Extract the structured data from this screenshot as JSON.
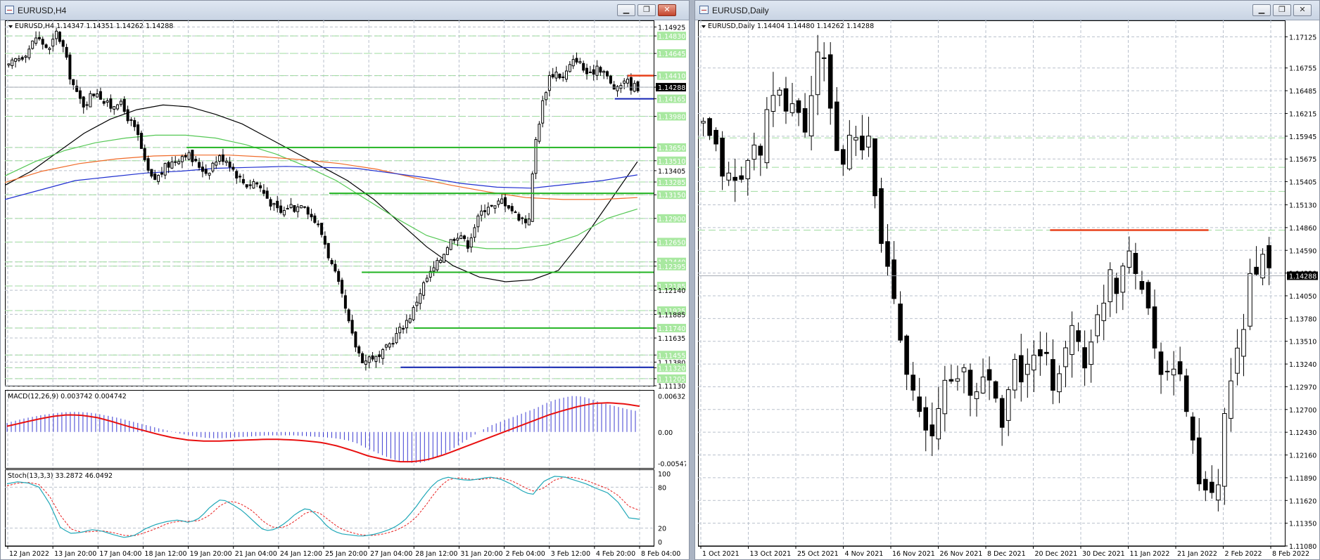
{
  "windows": [
    {
      "title": "EURUSD,H4",
      "symbol_info": "EURUSD,H4  1.14347 1.14351 1.14262 1.14288",
      "buttons": {
        "minimize": "",
        "maximize": "",
        "close": "✕"
      }
    },
    {
      "title": "EURUSD,Daily",
      "symbol_info": "EURUSD,Daily  1.14404 1.14480 1.14262 1.14288",
      "buttons": {
        "minimize": "",
        "maximize": "",
        "close": ""
      }
    }
  ],
  "colors": {
    "bull_fill": "#ffffff",
    "bear_fill": "#000000",
    "grid": "#b9c0cc",
    "level_line": "#9fdc9f",
    "level_label_bg": "#a8e8a0",
    "price_label_bg": "#000000",
    "ma_black": "#000000",
    "ma_green": "#55c855",
    "ma_orange": "#f06a28",
    "ma_blue": "#2030d0",
    "support_green": "#22b422",
    "support_blue": "#1424b4",
    "resistance_red": "#e8401a",
    "macd_hist": "#3c3cd2",
    "macd_signal": "#e81010",
    "stoch_main": "#20a8b8",
    "stoch_signal": "#e82020"
  },
  "chart_data": [
    {
      "id": "eurusd-h4",
      "type": "candlestick",
      "symbol": "EURUSD",
      "timeframe": "H4",
      "ohlc_text": "1.14347 1.14351 1.14262 1.14288",
      "current_price": "1.14288",
      "ylim": [
        1.1113,
        1.1495
      ],
      "y_ticks": [
        "1.14925",
        "1.14830",
        "1.14645",
        "1.14410",
        "1.14288",
        "1.14165",
        "1.13980",
        "1.13650",
        "1.13510",
        "1.13405",
        "1.13285",
        "1.13150",
        "1.12900",
        "1.12650",
        "1.12440",
        "1.12395",
        "1.12185",
        "1.12140",
        "1.11925",
        "1.11885",
        "1.11740",
        "1.11635",
        "1.11455",
        "1.11380",
        "1.11320",
        "1.11205",
        "1.11130"
      ],
      "green_level_labels": [
        "1.14830",
        "1.14645",
        "1.14410",
        "1.14165",
        "1.13980",
        "1.13650",
        "1.13510",
        "1.13285",
        "1.13150",
        "1.12900",
        "1.12650",
        "1.12440",
        "1.12395",
        "1.12185",
        "1.11925",
        "1.11740",
        "1.11455",
        "1.11320",
        "1.11205"
      ],
      "x_ticks": [
        "12 Jan 2022",
        "13 Jan 20:00",
        "17 Jan 04:00",
        "18 Jan 12:00",
        "19 Jan 20:00",
        "21 Jan 04:00",
        "24 Jan 12:00",
        "25 Jan 20:00",
        "27 Jan 04:00",
        "28 Jan 12:00",
        "31 Jan 20:00",
        "2 Feb 04:00",
        "3 Feb 12:00",
        "4 Feb 20:00",
        "8 Feb 04:00"
      ],
      "close_path": [
        1.145,
        1.1458,
        1.1462,
        1.147,
        1.1482,
        1.1475,
        1.1468,
        1.1487,
        1.147,
        1.144,
        1.142,
        1.141,
        1.142,
        1.1425,
        1.1412,
        1.1408,
        1.1415,
        1.1402,
        1.139,
        1.1375,
        1.1345,
        1.133,
        1.1335,
        1.1345,
        1.135,
        1.1355,
        1.136,
        1.135,
        1.1345,
        1.1338,
        1.135,
        1.1355,
        1.1352,
        1.134,
        1.133,
        1.1325,
        1.133,
        1.132,
        1.131,
        1.13,
        1.1295,
        1.1305,
        1.13,
        1.131,
        1.1295,
        1.1285,
        1.127,
        1.1245,
        1.1225,
        1.12,
        1.117,
        1.115,
        1.1138,
        1.1145,
        1.114,
        1.115,
        1.116,
        1.117,
        1.118,
        1.119,
        1.121,
        1.1225,
        1.1235,
        1.1245,
        1.126,
        1.127,
        1.1275,
        1.126,
        1.128,
        1.1295,
        1.1305,
        1.13,
        1.131,
        1.1305,
        1.1295,
        1.129,
        1.1285,
        1.137,
        1.141,
        1.144,
        1.1445,
        1.1438,
        1.145,
        1.146,
        1.1448,
        1.144,
        1.1452,
        1.1446,
        1.1432,
        1.1425,
        1.1438,
        1.143,
        1.1429
      ],
      "moving_averages": [
        {
          "color_key": "ma_black",
          "values": [
            1.1325,
            1.134,
            1.136,
            1.138,
            1.1395,
            1.1405,
            1.141,
            1.1408,
            1.14,
            1.139,
            1.1375,
            1.136,
            1.1345,
            1.133,
            1.131,
            1.1285,
            1.126,
            1.124,
            1.1228,
            1.1223,
            1.1225,
            1.1235,
            1.127,
            1.131,
            1.135
          ]
        },
        {
          "color_key": "ma_green",
          "values": [
            1.1335,
            1.135,
            1.1362,
            1.137,
            1.1375,
            1.1378,
            1.1378,
            1.1375,
            1.1368,
            1.1358,
            1.1345,
            1.133,
            1.131,
            1.129,
            1.1272,
            1.1262,
            1.1258,
            1.1258,
            1.1262,
            1.1272,
            1.129,
            1.13
          ]
        },
        {
          "color_key": "ma_orange",
          "values": [
            1.1328,
            1.134,
            1.1348,
            1.1353,
            1.1356,
            1.1357,
            1.1357,
            1.1355,
            1.1352,
            1.1348,
            1.1342,
            1.1333,
            1.1325,
            1.1318,
            1.1312,
            1.131,
            1.131,
            1.1312
          ]
        },
        {
          "color_key": "ma_blue",
          "values": [
            1.131,
            1.132,
            1.133,
            1.1334,
            1.1338,
            1.134,
            1.1343,
            1.1344,
            1.1345,
            1.1344,
            1.1343,
            1.1338,
            1.1333,
            1.1327,
            1.1323,
            1.1322,
            1.1326,
            1.133,
            1.1336
          ]
        }
      ],
      "support_resistance": [
        {
          "color_key": "support_green",
          "value": 1.1365,
          "from": 0.28,
          "to": 1.0
        },
        {
          "color_key": "support_green",
          "value": 1.13165,
          "from": 0.5,
          "to": 1.0
        },
        {
          "color_key": "support_green",
          "value": 1.1233,
          "from": 0.55,
          "to": 1.0
        },
        {
          "color_key": "support_green",
          "value": 1.1174,
          "from": 0.63,
          "to": 1.0
        },
        {
          "color_key": "support_blue",
          "value": 1.11325,
          "from": 0.61,
          "to": 1.0
        },
        {
          "color_key": "resistance_red",
          "value": 1.1441,
          "from": 0.96,
          "to": 1.0
        },
        {
          "color_key": "support_blue",
          "value": 1.14165,
          "from": 0.94,
          "to": 1.0
        }
      ],
      "macd": {
        "label": "MACD(12,26,9) 0.003742 0.004742",
        "y_ticks": [
          "0.006321",
          "0.00",
          "-0.005476"
        ],
        "ylim": [
          -0.0058,
          0.0066
        ],
        "histogram": [
          0.0016,
          0.002,
          0.0024,
          0.0027,
          0.003,
          0.0032,
          0.0034,
          0.0035,
          0.0035,
          0.0034,
          0.0032,
          0.0029,
          0.0026,
          0.0022,
          0.0018,
          0.0014,
          0.001,
          0.0006,
          0.0002,
          -0.0002,
          -0.0005,
          -0.0008,
          -0.001,
          -0.0011,
          -0.0011,
          -0.001,
          -0.0009,
          -0.0008,
          -0.0007,
          -0.0006,
          -0.0006,
          -0.0006,
          -0.0006,
          -0.0007,
          -0.0008,
          -0.0009,
          -0.001,
          -0.0012,
          -0.0015,
          -0.002,
          -0.0028,
          -0.0035,
          -0.0042,
          -0.0048,
          -0.0052,
          -0.0054,
          -0.0054,
          -0.005,
          -0.0044,
          -0.0036,
          -0.0026,
          -0.0016,
          -0.0006,
          0.0004,
          0.0012,
          0.0018,
          0.0024,
          0.003,
          0.0036,
          0.0042,
          0.005,
          0.0056,
          0.006,
          0.0063,
          0.0062,
          0.0058,
          0.0052,
          0.0048,
          0.0044,
          0.004,
          0.0037
        ],
        "signal": [
          0.001,
          0.0016,
          0.0022,
          0.0027,
          0.003,
          0.0029,
          0.0025,
          0.0018,
          0.001,
          0.0003,
          -0.0004,
          -0.001,
          -0.0014,
          -0.0016,
          -0.0016,
          -0.0015,
          -0.0014,
          -0.0013,
          -0.0013,
          -0.0014,
          -0.0016,
          -0.0019,
          -0.0025,
          -0.0033,
          -0.0042,
          -0.0048,
          -0.0052,
          -0.0052,
          -0.0048,
          -0.004,
          -0.003,
          -0.002,
          -0.001,
          0.0,
          0.001,
          0.002,
          0.003,
          0.0038,
          0.0045,
          0.005,
          0.0051,
          0.0049,
          0.0045
        ]
      },
      "stochastic": {
        "label": "Stoch(13,3,3) 33.2872 46.0492",
        "y_ticks": [
          "100",
          "80",
          "20",
          "0"
        ],
        "ylim": [
          0,
          100
        ],
        "main": [
          85,
          88,
          86,
          80,
          55,
          20,
          12,
          14,
          18,
          15,
          10,
          6,
          10,
          20,
          26,
          30,
          32,
          28,
          35,
          52,
          63,
          55,
          45,
          30,
          16,
          18,
          28,
          42,
          50,
          38,
          20,
          12,
          10,
          8,
          10,
          14,
          20,
          30,
          48,
          70,
          88,
          95,
          92,
          90,
          92,
          95,
          92,
          85,
          75,
          68,
          88,
          96,
          95,
          90,
          85,
          78,
          72,
          58,
          35,
          33
        ],
        "signal": [
          82,
          86,
          87,
          84,
          66,
          38,
          18,
          14,
          15,
          16,
          13,
          9,
          9,
          14,
          20,
          27,
          30,
          30,
          31,
          40,
          55,
          60,
          54,
          44,
          28,
          20,
          22,
          32,
          44,
          44,
          32,
          20,
          14,
          10,
          9,
          11,
          15,
          22,
          33,
          52,
          74,
          90,
          94,
          92,
          91,
          93,
          94,
          90,
          82,
          74,
          78,
          90,
          95,
          94,
          90,
          84,
          78,
          68,
          52,
          46
        ]
      }
    },
    {
      "id": "eurusd-daily",
      "type": "candlestick",
      "symbol": "EURUSD",
      "timeframe": "Daily",
      "ohlc_text": "1.14404 1.14480 1.14262 1.14288",
      "current_price": "1.14288",
      "ylim": [
        1.1108,
        1.1727
      ],
      "y_ticks": [
        "1.17125",
        "1.16755",
        "1.16485",
        "1.16215",
        "1.15945",
        "1.15675",
        "1.15405",
        "1.15130",
        "1.14860",
        "1.14590",
        "1.14320",
        "1.14050",
        "1.13780",
        "1.13510",
        "1.13240",
        "1.12970",
        "1.12700",
        "1.12430",
        "1.12160",
        "1.11890",
        "1.11620",
        "1.11350",
        "1.11080"
      ],
      "green_level_labels": [
        "1.15925",
        "1.15575",
        "1.15290",
        "1.14830"
      ],
      "x_ticks": [
        "1 Oct 2021",
        "13 Oct 2021",
        "25 Oct 2021",
        "4 Nov 2021",
        "16 Nov 2021",
        "26 Nov 2021",
        "8 Dec 2021",
        "20 Dec 2021",
        "30 Dec 2021",
        "11 Jan 2022",
        "21 Jan 2022",
        "2 Feb 2022",
        "8 Feb 2022"
      ],
      "close_path": [
        1.16,
        1.159,
        1.1565,
        1.1555,
        1.153,
        1.1545,
        1.156,
        1.1575,
        1.159,
        1.162,
        1.164,
        1.163,
        1.164,
        1.162,
        1.1605,
        1.165,
        1.169,
        1.167,
        1.16,
        1.156,
        1.158,
        1.159,
        1.157,
        1.159,
        1.1495,
        1.145,
        1.142,
        1.137,
        1.133,
        1.13,
        1.125,
        1.123,
        1.124,
        1.13,
        1.132,
        1.13,
        1.131,
        1.128,
        1.13,
        1.132,
        1.129,
        1.126,
        1.129,
        1.132,
        1.131,
        1.133,
        1.132,
        1.133,
        1.13,
        1.132,
        1.134,
        1.137,
        1.135,
        1.132,
        1.136,
        1.14,
        1.144,
        1.142,
        1.145,
        1.148,
        1.142,
        1.141,
        1.135,
        1.133,
        1.132,
        1.131,
        1.13,
        1.126,
        1.12,
        1.116,
        1.116,
        1.118,
        1.126,
        1.13,
        1.135,
        1.141,
        1.145,
        1.144,
        1.1429
      ],
      "support_resistance": [
        {
          "color_key": "resistance_red",
          "value": 1.1483,
          "from": 0.6,
          "to": 0.87
        }
      ]
    }
  ]
}
